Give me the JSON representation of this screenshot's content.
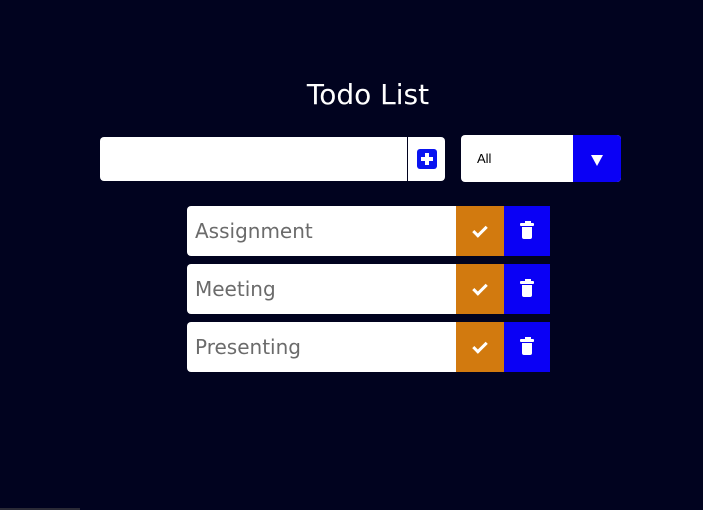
{
  "header": {
    "title": "Todo List"
  },
  "form": {
    "input_value": "",
    "input_placeholder": "",
    "add_icon": "plus-square-icon",
    "filter": {
      "selected": "All",
      "arrow_icon": "caret-down-icon"
    }
  },
  "todos": [
    {
      "text": "Assignment"
    },
    {
      "text": "Meeting"
    },
    {
      "text": "Presenting"
    }
  ],
  "colors": {
    "background": "#01031f",
    "check_button": "#d27a0f",
    "trash_button": "#0a00f5",
    "add_icon": "#0a14f0",
    "todo_text": "#6b6b6b"
  },
  "icons": {
    "complete": "check-icon",
    "delete": "trash-icon"
  }
}
